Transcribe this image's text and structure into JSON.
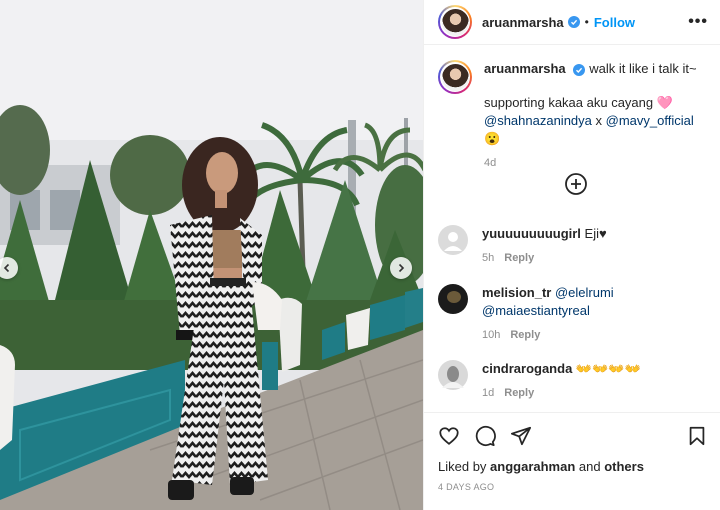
{
  "post": {
    "username": "aruanmarsha",
    "follow_label": "Follow",
    "more_label": "•••",
    "separator": "•"
  },
  "caption": {
    "username": "aruanmarsha",
    "line1": "walk it like i talk it~",
    "line2": "supporting kakaa aku cayang 🩷",
    "mention1": "@shahnazanindya",
    "joiner": " x ",
    "mention2": "@mavy_official",
    "emoji": " 😮",
    "age": "4d"
  },
  "comments": [
    {
      "username": "yuuuuuuuuugirl",
      "text": " Eji♥",
      "age": "5h",
      "reply": "Reply"
    },
    {
      "username": "melision_tr",
      "mention1": "@elelrumi",
      "mention2": "@maiaestiantyreal",
      "age": "10h",
      "reply": "Reply"
    },
    {
      "username": "cindraroganda",
      "text": " 👐👐👐👐",
      "age": "1d",
      "reply": "Reply"
    }
  ],
  "footer": {
    "liked_by_prefix": "Liked by ",
    "liked_by_user": "anggarahman",
    "and": " and ",
    "others": "others",
    "date": "4 DAYS AGO"
  },
  "icons": [
    "heart-icon",
    "comment-icon",
    "share-icon",
    "bookmark-icon",
    "plus-circle-icon",
    "chevron-left-icon",
    "chevron-right-icon",
    "verified-icon"
  ],
  "colors": {
    "link": "#0095f6",
    "mention": "#00376b",
    "muted": "#8e8e8e",
    "planter": "#1f7c86"
  }
}
